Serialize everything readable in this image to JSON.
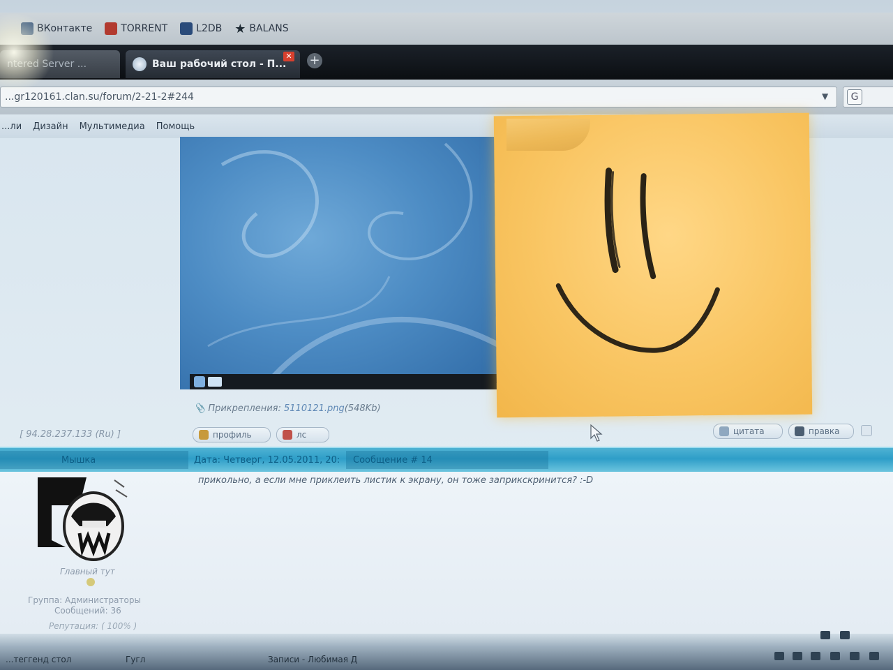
{
  "bookmarks": [
    {
      "label": "ВКонтакте",
      "icon": "vk-icon",
      "color": "#3b5a80"
    },
    {
      "label": "TORRENT",
      "icon": "torrent-icon",
      "color": "#b23a2f"
    },
    {
      "label": "L2DB",
      "icon": "l2db-icon",
      "color": "#2a4b7a"
    },
    {
      "label": "BALANS",
      "icon": "star-icon",
      "color": "#1e2a33"
    }
  ],
  "tabs": {
    "inactive_label": "ntered Server ...",
    "active_label": "Ваш рабочий стол - П...",
    "close_glyph": "✕",
    "new_tab_glyph": "+"
  },
  "address_bar": {
    "url": "...gr120161.clan.su/forum/2-21-2#244",
    "search_glyph": "G"
  },
  "site_menu": [
    "...ли",
    "Дизайн",
    "Мультимедиа",
    "Помощь"
  ],
  "post1": {
    "attach_label": "Прикрепления:",
    "attach_file": "5110121.png",
    "attach_size": "(548Kb)",
    "ip": "[ 94.28.237.133 (Ru) ]",
    "buttons": {
      "profile": "профиль",
      "pm": "лс",
      "quote": "цитата",
      "edit": "правка"
    }
  },
  "post2_header": {
    "author": "Мышка",
    "date": "Дата: Четверг, 12.05.2011, 20:",
    "message_no": "Сообщение # 14"
  },
  "post2": {
    "user_title": "Главный тут",
    "group": "Группа: Администраторы",
    "posts": "Сообщений: 36",
    "reputation": "Репутация: ( 100% )",
    "text": "прикольно, а если мне приклеить листик к экрану, он тоже заприкскринится? :-D"
  },
  "taskbar": {
    "item1": "...теггенд стол",
    "item2": "Гугл",
    "item3": "Записи - Любимая Д"
  },
  "sticky_note": {
    "drawing": "smiley-face",
    "color": "#f9c562"
  },
  "colors": {
    "header_bar": "#2e9ec8",
    "link": "#5f88b5",
    "note": "#f9c562"
  }
}
